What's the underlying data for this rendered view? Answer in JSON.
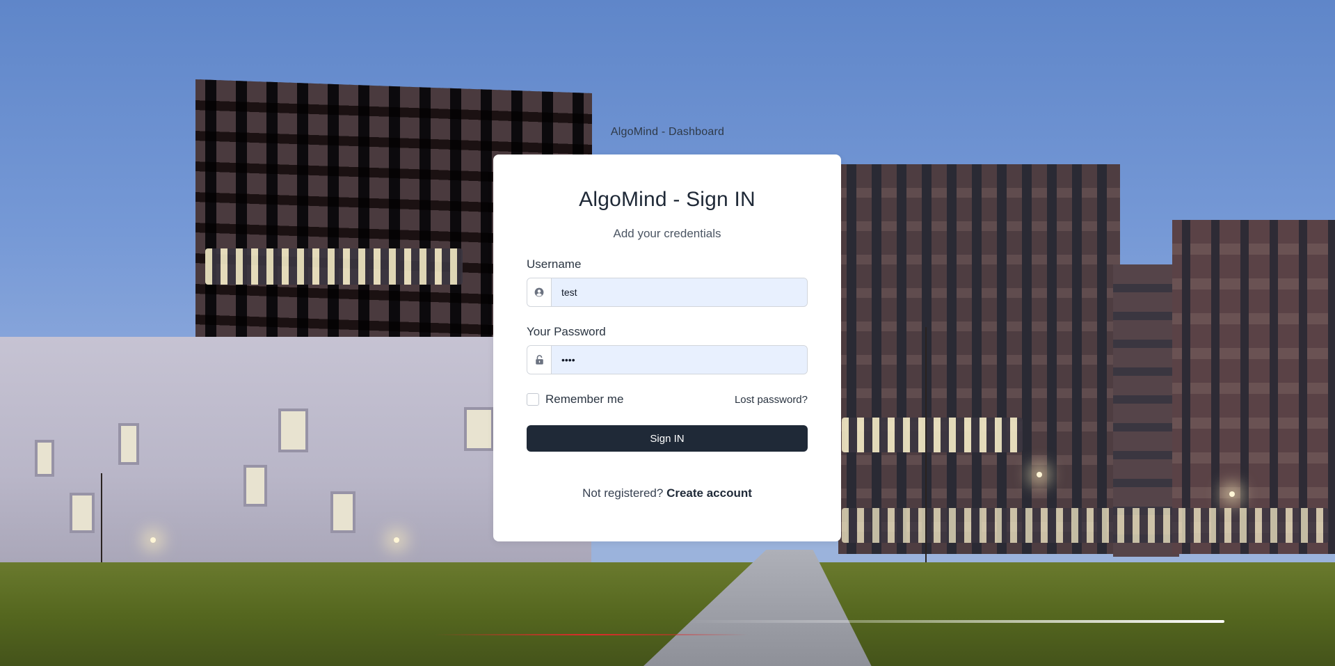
{
  "page": {
    "header": "AlgoMind - Dashboard"
  },
  "card": {
    "title": "AlgoMind - Sign IN",
    "subtitle": "Add your credentials"
  },
  "form": {
    "username": {
      "label": "Username",
      "value": "test",
      "icon": "user-circle-icon"
    },
    "password": {
      "label": "Your Password",
      "value": "••••",
      "icon": "unlock-icon"
    },
    "remember_label": "Remember me",
    "remember_checked": false,
    "lost_password": "Lost password?",
    "submit_label": "Sign IN"
  },
  "register": {
    "prompt": "Not registered?",
    "link": "Create account"
  },
  "colors": {
    "button_bg": "#1f2937",
    "input_bg": "#e8f0fe",
    "card_bg": "#ffffff"
  }
}
